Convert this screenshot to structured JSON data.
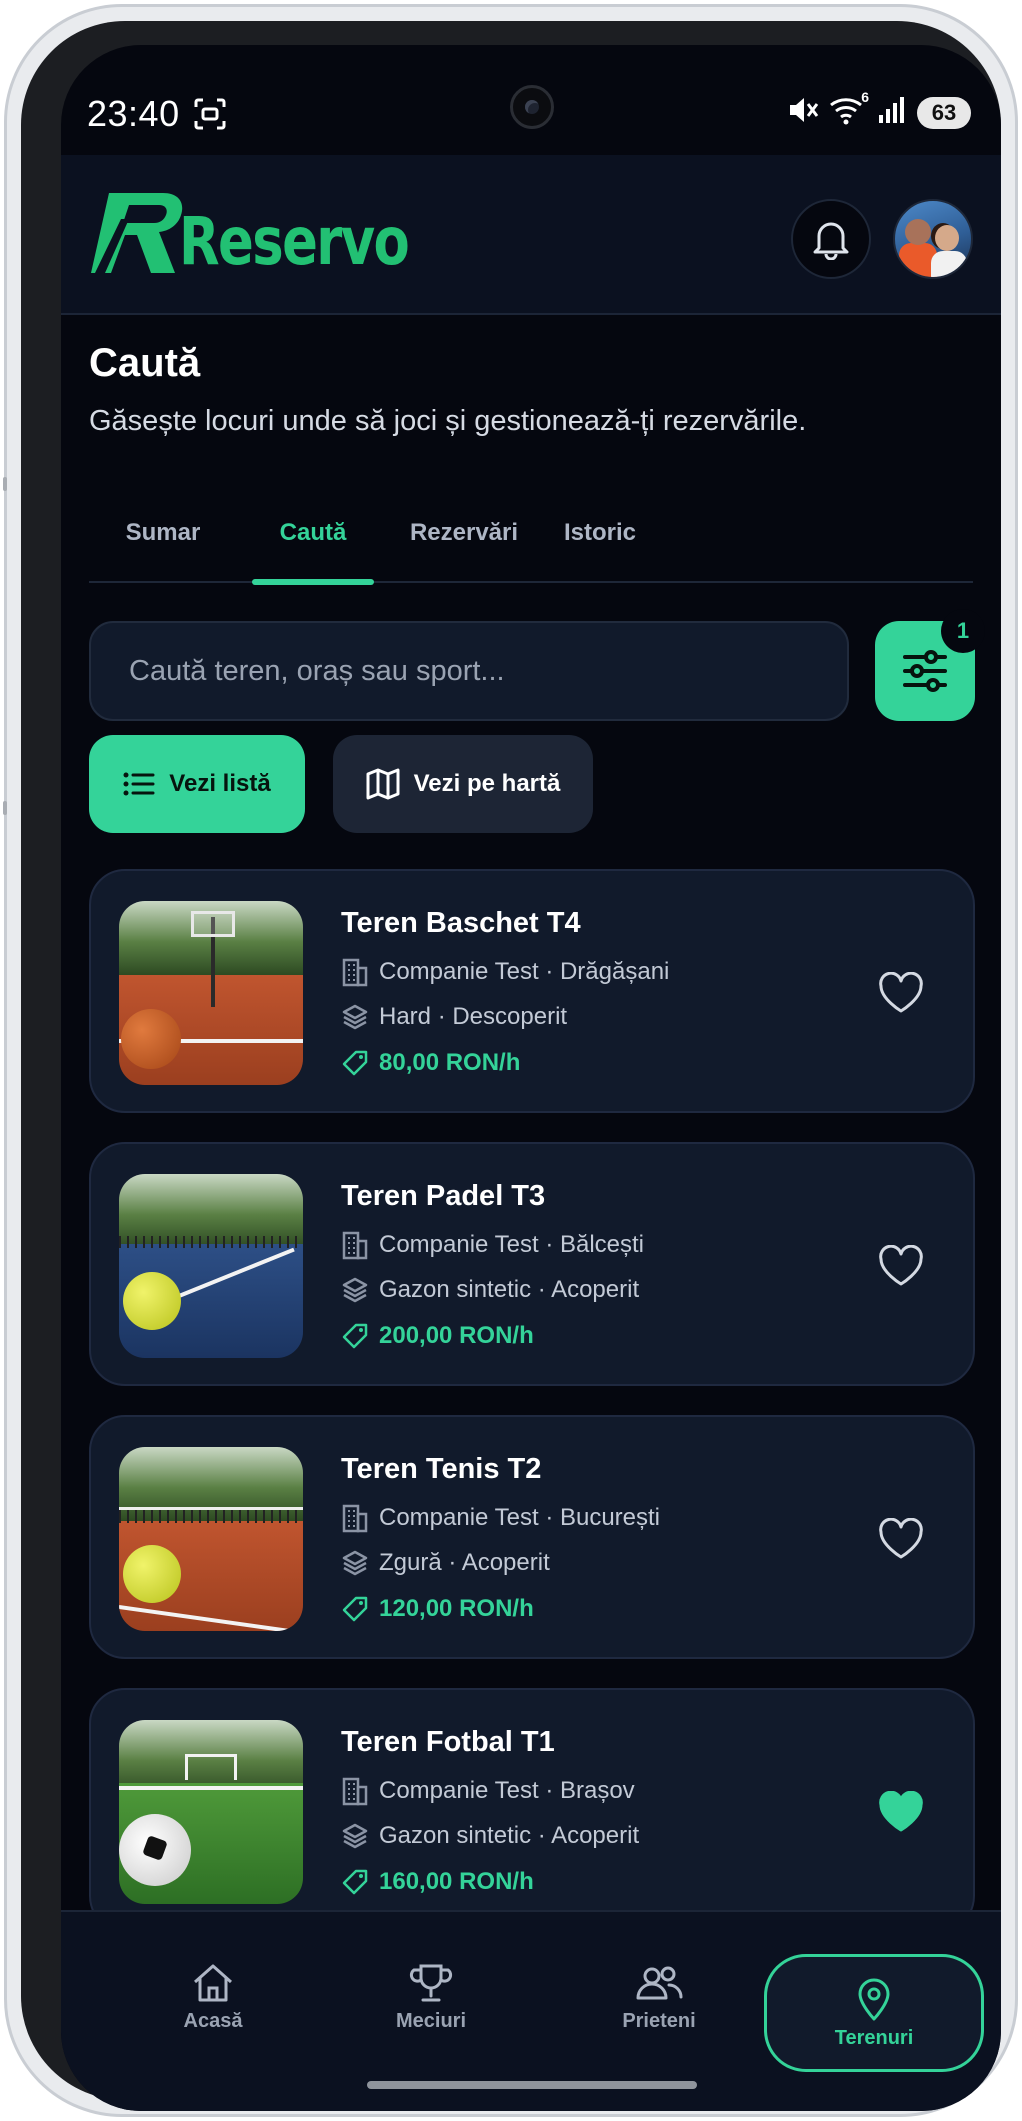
{
  "status_bar": {
    "time": "23:40",
    "network_superscript": "6",
    "battery": "63"
  },
  "header": {
    "logo_text": "Reservo",
    "brand_color": "#22c073"
  },
  "page": {
    "title": "Caută",
    "subtitle": "Găsește locuri unde să joci și gestionează-ți rezervările."
  },
  "tabs": [
    {
      "label": "Sumar",
      "active": false
    },
    {
      "label": "Caută",
      "active": true
    },
    {
      "label": "Rezervări",
      "active": false
    },
    {
      "label": "Istoric",
      "active": false
    }
  ],
  "search": {
    "placeholder": "Caută teren, oraș sau sport...",
    "value": "",
    "filter_count": "1"
  },
  "view_toggle": {
    "list_label": "Vezi listă",
    "map_label": "Vezi pe hartă",
    "active": "list"
  },
  "courts": [
    {
      "name": "Teren Baschet T4",
      "location": "Companie Test · Drăgășani",
      "surface": "Hard · Descoperit",
      "price": "80,00 RON/h",
      "favorite": false,
      "image_icon": "basketball-court"
    },
    {
      "name": "Teren Padel T3",
      "location": "Companie Test · Bălcești",
      "surface": "Gazon sintetic · Acoperit",
      "price": "200,00 RON/h",
      "favorite": false,
      "image_icon": "padel-court"
    },
    {
      "name": "Teren Tenis T2",
      "location": "Companie Test · București",
      "surface": "Zgură · Acoperit",
      "price": "120,00 RON/h",
      "favorite": false,
      "image_icon": "tennis-court"
    },
    {
      "name": "Teren Fotbal T1",
      "location": "Companie Test · Brașov",
      "surface": "Gazon sintetic · Acoperit",
      "price": "160,00 RON/h",
      "favorite": true,
      "image_icon": "football-field"
    }
  ],
  "bottom_nav": [
    {
      "label": "Acasă",
      "icon": "home-icon",
      "active": false
    },
    {
      "label": "Meciuri",
      "icon": "trophy-icon",
      "active": false
    },
    {
      "label": "Prieteni",
      "icon": "friends-icon",
      "active": false
    },
    {
      "label": "Terenuri",
      "icon": "location-pin-icon",
      "active": true
    }
  ],
  "colors": {
    "accent": "#34d399",
    "background": "#05070f",
    "card": "#111a2b"
  }
}
